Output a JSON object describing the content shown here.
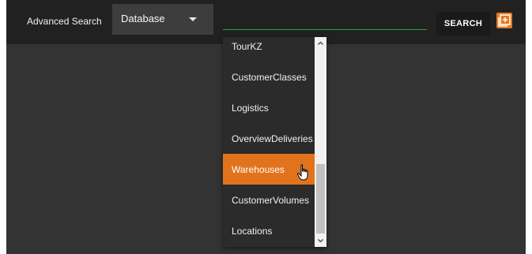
{
  "header": {
    "title": "Advanced Search",
    "database_select": {
      "selected": "Database"
    },
    "search": {
      "value": "",
      "placeholder": ""
    },
    "search_button_label": "SEARCH",
    "add_icon": "add-box-icon"
  },
  "dropdown": {
    "items": [
      {
        "label": "TourKZ"
      },
      {
        "label": "CustomerClasses"
      },
      {
        "label": "Logistics"
      },
      {
        "label": "OverviewDeliveries"
      },
      {
        "label": "Warehouses"
      },
      {
        "label": "CustomerVolumes"
      },
      {
        "label": "Locations"
      }
    ],
    "selected_index": 4
  },
  "colors": {
    "accent": "#e2731d",
    "topbar": "#212121",
    "background": "#333333",
    "search_underline": "#2e9e3e"
  }
}
